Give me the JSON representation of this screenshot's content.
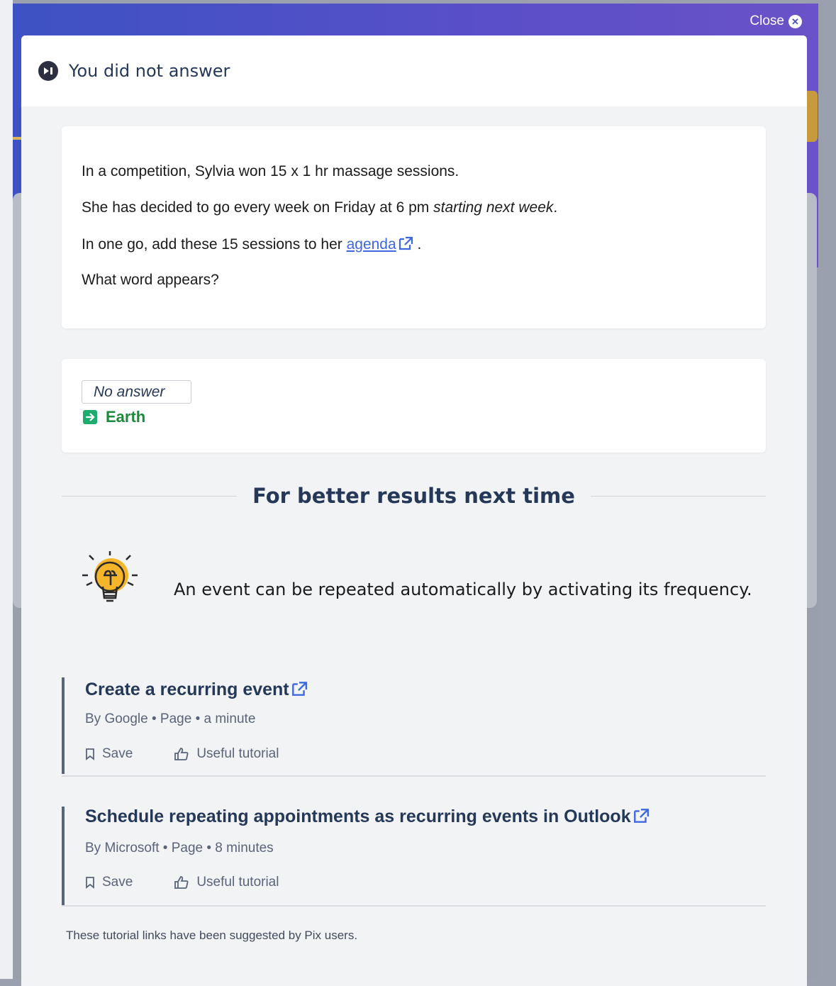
{
  "close_label": "Close",
  "header": {
    "title": "You did not answer"
  },
  "challenge": {
    "lines": [
      "In a competition, Sylvia won 15 x 1 hr massage sessions.",
      "She has decided to go every week on Friday at 6 pm ",
      "In one go, add these 15 sessions to her ",
      "What word appears?"
    ],
    "italic_part": "starting next week",
    "period": ".",
    "link_text": "agenda",
    "link_suffix": " ."
  },
  "answer": {
    "given": "No answer",
    "solution": "Earth"
  },
  "learning": {
    "section_title": "For better results next time",
    "hint": "An event can be repeated automatically by activating its frequency."
  },
  "tutorials": [
    {
      "title": "Create a recurring event",
      "meta": "By Google • Page • a minute",
      "save_label": "Save",
      "useful_label": "Useful tutorial"
    },
    {
      "title": "Schedule repeating appointments as recurring events in Outlook",
      "meta": "By Microsoft • Page • 8 minutes",
      "save_label": "Save",
      "useful_label": "Useful tutorial"
    }
  ],
  "footer_note": "These tutorial links have been suggested by Pix users.",
  "colors": {
    "accent_blue": "#3d68e0",
    "title_navy": "#253858",
    "solution_green": "#1a8a3d",
    "bulb_yellow": "#f5b52a"
  }
}
